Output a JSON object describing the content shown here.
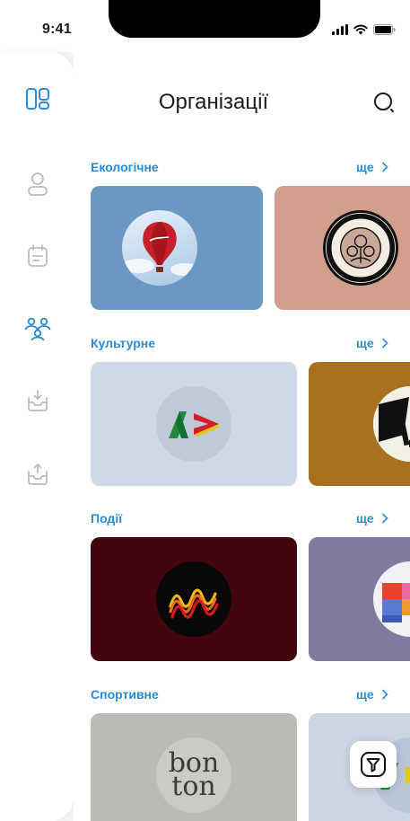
{
  "status_bar": {
    "time": "9:41"
  },
  "header": {
    "title": "Організації"
  },
  "sidebar": {
    "items": [
      {
        "icon": "dashboard-icon",
        "active": true
      },
      {
        "icon": "profile-icon",
        "active": false
      },
      {
        "icon": "calendar-icon",
        "active": false
      },
      {
        "icon": "organizations-icon",
        "active": true
      },
      {
        "icon": "inbox-download-icon",
        "active": false
      },
      {
        "icon": "inbox-upload-icon",
        "active": false
      }
    ]
  },
  "sections": [
    {
      "title": "Екологічне",
      "more_label": "ще"
    },
    {
      "title": "Культурне",
      "more_label": "ще"
    },
    {
      "title": "Події",
      "more_label": "ще"
    },
    {
      "title": "Спортивне",
      "more_label": "ще"
    }
  ],
  "cards": {
    "bonton_logo_line1": "bon",
    "bonton_logo_line2": "ton"
  },
  "colors": {
    "accent": "#2a8bd6",
    "active_icon": "#2a8bd6",
    "inactive_icon": "#b8bcc4",
    "card_eco_1": "#6b97c3",
    "card_eco_2": "#d49e8c",
    "card_culture_1": "#cfd8e6",
    "card_culture_2": "#a8701f",
    "card_events_1": "#43060c",
    "card_events_2": "#7f7a9f",
    "card_sport_1": "#b9bcb5",
    "card_sport_2": "#ccd5e2"
  }
}
